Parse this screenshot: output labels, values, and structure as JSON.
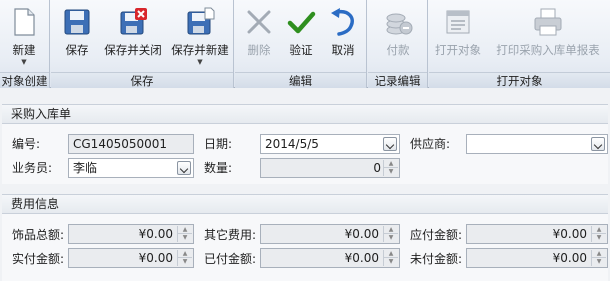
{
  "ribbon": {
    "groups": [
      {
        "label": "对象创建",
        "buttons": [
          {
            "label": "新建",
            "icon": "new-document-icon",
            "dropdown": true
          }
        ]
      },
      {
        "label": "保存",
        "buttons": [
          {
            "label": "保存",
            "icon": "save-icon"
          },
          {
            "label": "保存并关闭",
            "icon": "save-close-icon"
          },
          {
            "label": "保存并新建",
            "icon": "save-new-icon",
            "dropdown": true
          }
        ]
      },
      {
        "label": "编辑",
        "buttons": [
          {
            "label": "删除",
            "icon": "delete-x-icon",
            "disabled": true
          },
          {
            "label": "验证",
            "icon": "checkmark-icon"
          },
          {
            "label": "取消",
            "icon": "undo-arrow-icon"
          }
        ]
      },
      {
        "label": "记录编辑",
        "buttons": [
          {
            "label": "付款",
            "icon": "coins-icon",
            "disabled": true
          }
        ]
      },
      {
        "label": "打开对象",
        "buttons": [
          {
            "label": "打开对象",
            "icon": "open-object-icon",
            "disabled": true
          },
          {
            "label": "打印采购入库单报表",
            "icon": "printer-icon",
            "disabled": true
          }
        ]
      }
    ]
  },
  "purchase_section": {
    "title": "采购入库单",
    "code_label": "编号:",
    "code_value": "CG1405050001",
    "date_label": "日期:",
    "date_value": "2014/5/5",
    "supplier_label": "供应商:",
    "supplier_value": "",
    "clerk_label": "业务员:",
    "clerk_value": "李临",
    "qty_label": "数量:",
    "qty_value": "0"
  },
  "cost_section": {
    "title": "费用信息",
    "goods_total_label": "饰品总额:",
    "goods_total_value": "¥0.00",
    "other_cost_label": "其它费用:",
    "other_cost_value": "¥0.00",
    "payable_label": "应付金额:",
    "payable_value": "¥0.00",
    "actual_paid_label": "实付金额:",
    "actual_paid_value": "¥0.00",
    "paid_label": "已付金额:",
    "paid_value": "¥0.00",
    "unpaid_label": "未付金额:",
    "unpaid_value": "¥0.00"
  },
  "colors": {
    "accent_green": "#2f8f1f",
    "accent_red": "#d8262c",
    "accent_blue": "#2b6cc4"
  }
}
